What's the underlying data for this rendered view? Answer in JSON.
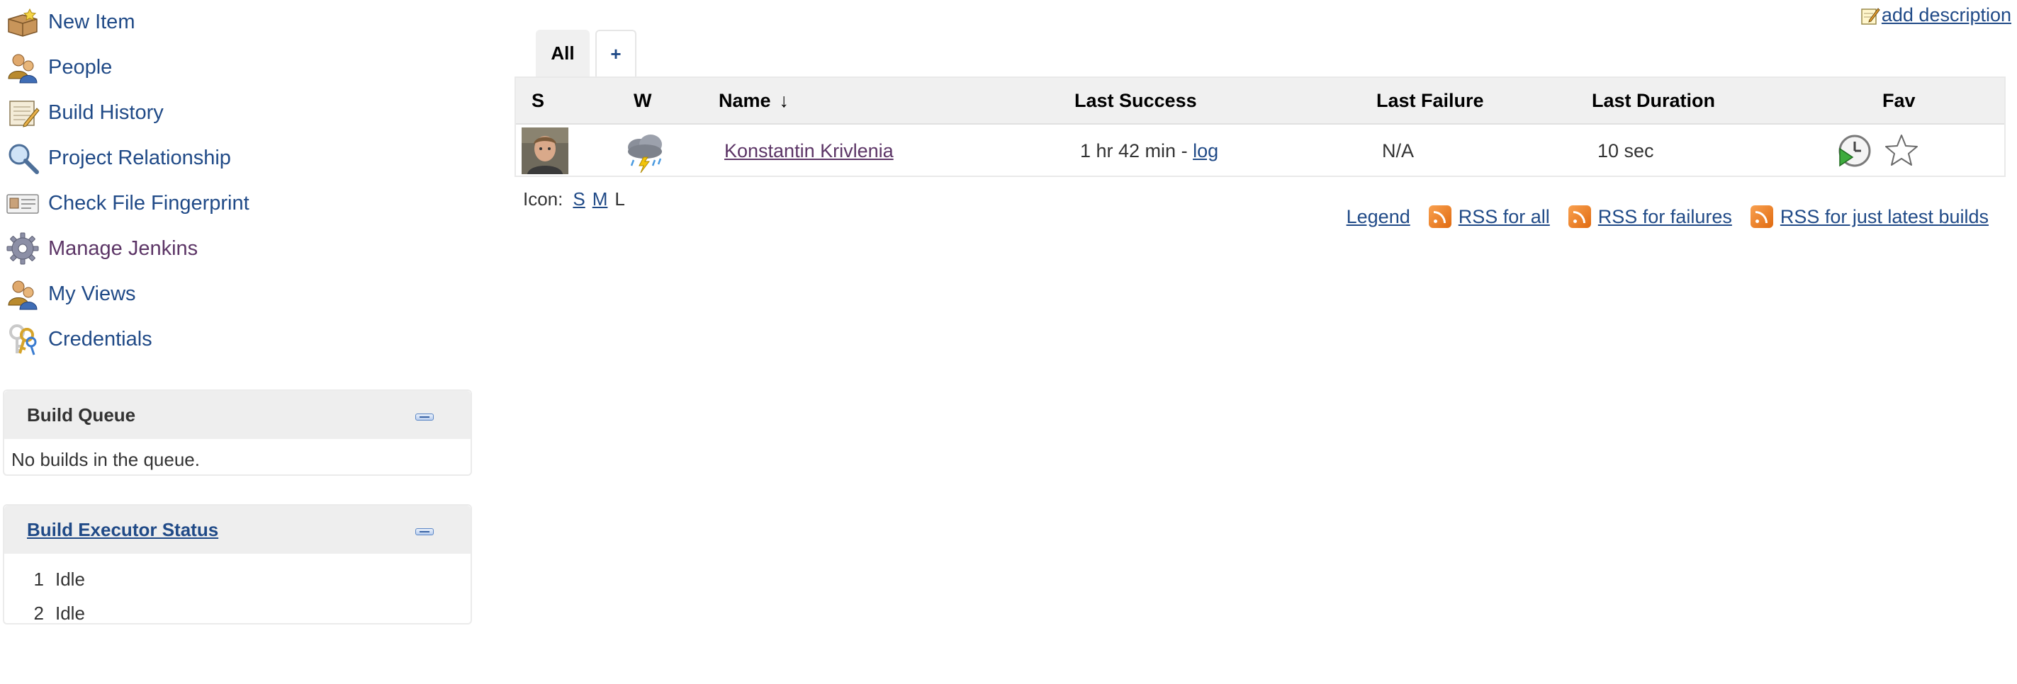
{
  "sidebar": {
    "items": [
      {
        "label": "New Item",
        "icon": "new-item-icon"
      },
      {
        "label": "People",
        "icon": "people-icon"
      },
      {
        "label": "Build History",
        "icon": "build-history-icon"
      },
      {
        "label": "Project Relationship",
        "icon": "magnifier-icon"
      },
      {
        "label": "Check File Fingerprint",
        "icon": "fingerprint-icon"
      },
      {
        "label": "Manage Jenkins",
        "icon": "gear-icon"
      },
      {
        "label": "My Views",
        "icon": "my-views-icon"
      },
      {
        "label": "Credentials",
        "icon": "keys-icon"
      }
    ]
  },
  "build_queue": {
    "title": "Build Queue",
    "empty_text": "No builds in the queue."
  },
  "executor_status": {
    "title": "Build Executor Status",
    "executors": [
      {
        "number": "1",
        "state": "Idle"
      },
      {
        "number": "2",
        "state": "Idle"
      }
    ]
  },
  "main": {
    "add_description": "add description",
    "tabs": [
      {
        "label": "All",
        "active": true
      },
      {
        "label": "+",
        "active": false
      }
    ],
    "table": {
      "columns": {
        "s": "S",
        "w": "W",
        "name": "Name",
        "sort_arrow": "↓",
        "last_success": "Last Success",
        "last_failure": "Last Failure",
        "last_duration": "Last Duration",
        "fav": "Fav"
      },
      "rows": [
        {
          "status_icon": "user-avatar-icon",
          "weather_icon": "thunderstorm-icon",
          "name": "Konstantin Krivlenia",
          "last_success": "1 hr 42 min -",
          "last_success_link": "log",
          "last_failure": "N/A",
          "last_duration": "10 sec",
          "actions": [
            "schedule-build-icon",
            "favorite-star-icon"
          ]
        }
      ]
    },
    "icon_size": {
      "label": "Icon:",
      "options": [
        "S",
        "M",
        "L"
      ],
      "current": "L"
    },
    "footer_links": {
      "legend": "Legend",
      "rss_all": "RSS for all",
      "rss_failures": "RSS for failures",
      "rss_latest": "RSS for just latest builds"
    }
  },
  "colors": {
    "link": "#204a87",
    "visited_link": "#5c3566",
    "header_bg": "#f0f0f0",
    "rss_orange": "#f0861f"
  }
}
